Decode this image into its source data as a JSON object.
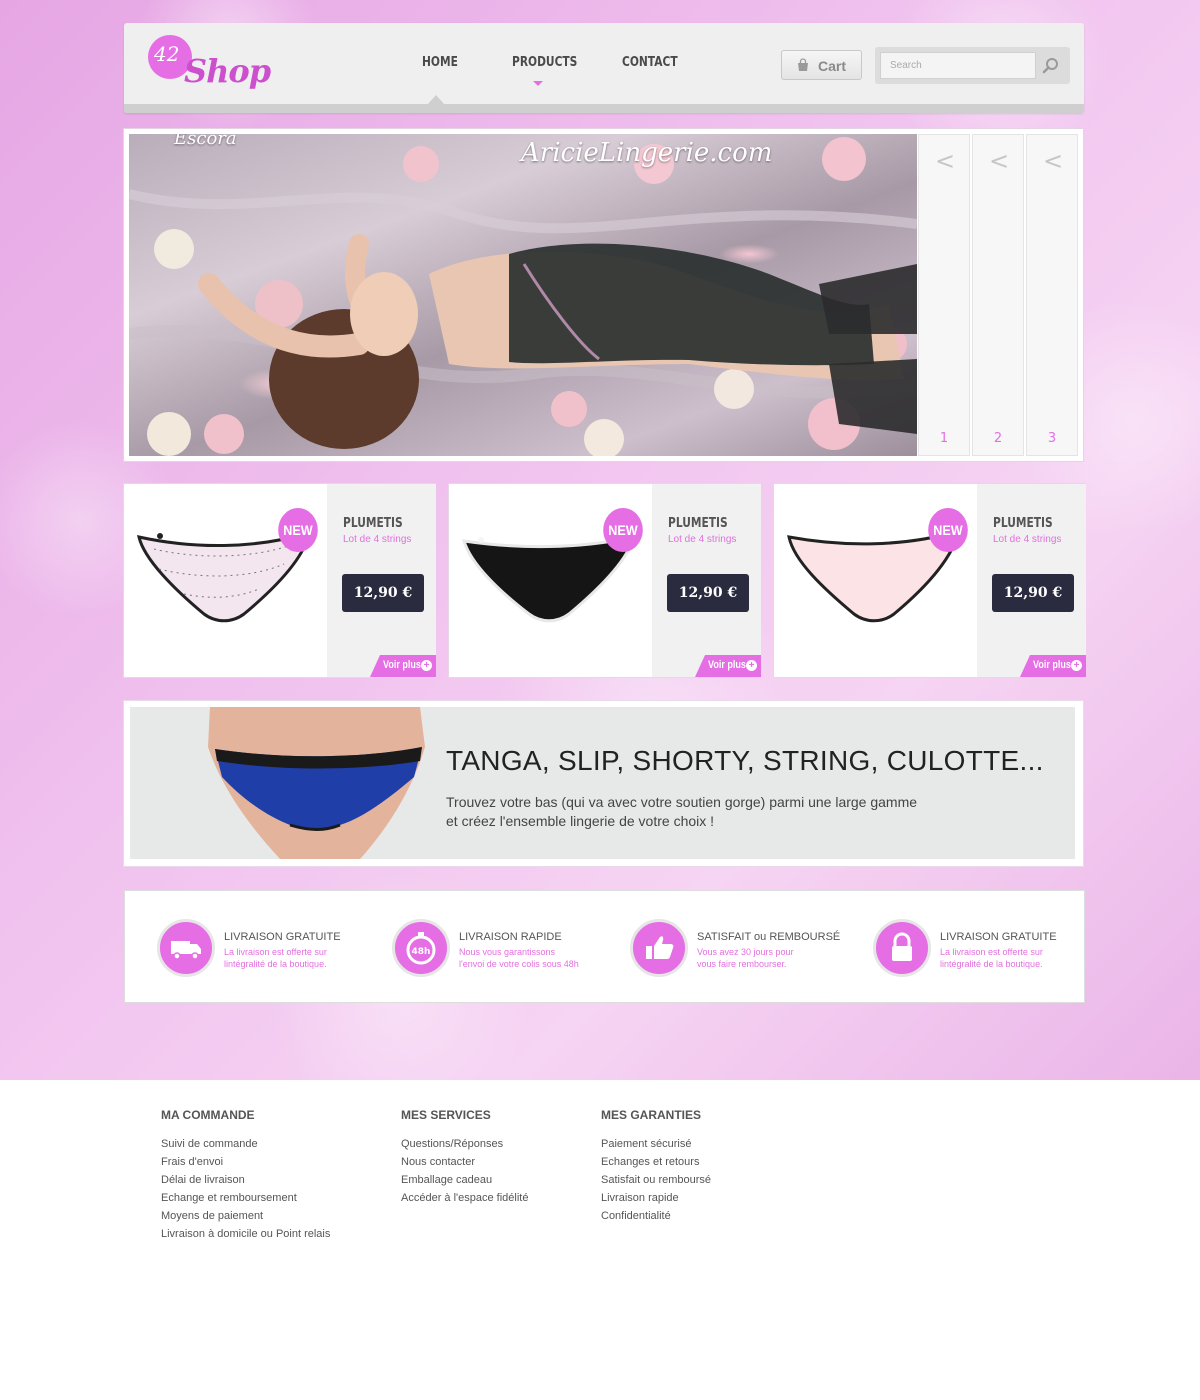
{
  "logo": {
    "number": "42",
    "name": "Shop"
  },
  "nav": [
    {
      "label": "HOME"
    },
    {
      "label": "PRODUCTS"
    },
    {
      "label": "CONTACT"
    }
  ],
  "cart": {
    "label": "Cart"
  },
  "search": {
    "placeholder": "Search"
  },
  "slider": {
    "overlay_texts": [
      "Escora",
      "AricieLingerie.com"
    ],
    "thumbs": [
      {
        "arrow": "<",
        "number": "1"
      },
      {
        "arrow": "<",
        "number": "2"
      },
      {
        "arrow": "<",
        "number": "3"
      }
    ]
  },
  "products": [
    {
      "badge": "NEW",
      "name": "PLUMETIS",
      "subtitle": "Lot de 4 strings",
      "price": "12,90 €",
      "more": "Voir plus",
      "color": "#f3e6ef"
    },
    {
      "badge": "NEW",
      "name": "PLUMETIS",
      "subtitle": "Lot de 4 strings",
      "price": "12,90 €",
      "more": "Voir plus",
      "color": "#151515"
    },
    {
      "badge": "NEW",
      "name": "PLUMETIS",
      "subtitle": "Lot de 4 strings",
      "price": "12,90 €",
      "more": "Voir plus",
      "color": "#fbe3e6"
    }
  ],
  "banner": {
    "title": "TANGA, SLIP, SHORTY, STRING, CULOTTE...",
    "line1": "Trouvez votre bas (qui va avec votre soutien gorge) parmi une large gamme",
    "line2": "et créez l'ensemble lingerie de votre choix !"
  },
  "features": [
    {
      "icon": "truck-icon",
      "title": "LIVRAISON GRATUITE",
      "line1": "La livraison est offerte sur",
      "line2": "lintégralité de la boutique."
    },
    {
      "icon": "timer-48h-icon",
      "title": "LIVRAISON RAPIDE",
      "line1": "Nous vous garantissons",
      "line2": "l'envoi de votre colis sous 48h",
      "icon_text": "48h"
    },
    {
      "icon": "thumbs-up-icon",
      "title": "SATISFAIT ou REMBOURSÉ",
      "line1": "Vous avez 30 jours pour",
      "line2": "vous faire rembourser."
    },
    {
      "icon": "lock-icon",
      "title": "LIVRAISON GRATUITE",
      "line1": "La livraison est offerte sur",
      "line2": "lintégralité de la boutique."
    }
  ],
  "footer": [
    {
      "title": "MA COMMANDE",
      "links": [
        "Suivi de commande",
        "Frais d'envoi",
        "Délai de livraison",
        "Echange et remboursement",
        "Moyens de paiement",
        "Livraison à domicile ou Point relais"
      ]
    },
    {
      "title": "MES SERVICES",
      "links": [
        "Questions/Réponses",
        "Nous contacter",
        "Emballage cadeau",
        "Accéder à l'espace fidélité"
      ]
    },
    {
      "title": "MES GARANTIES",
      "links": [
        "Paiement sécurisé",
        "Echanges et retours",
        "Satisfait ou remboursé",
        "Livraison rapide",
        "Confidentialité"
      ]
    }
  ],
  "colors": {
    "accent": "#e56ee5",
    "price_bg": "#2b2b40",
    "header_bg": "#efefef"
  }
}
